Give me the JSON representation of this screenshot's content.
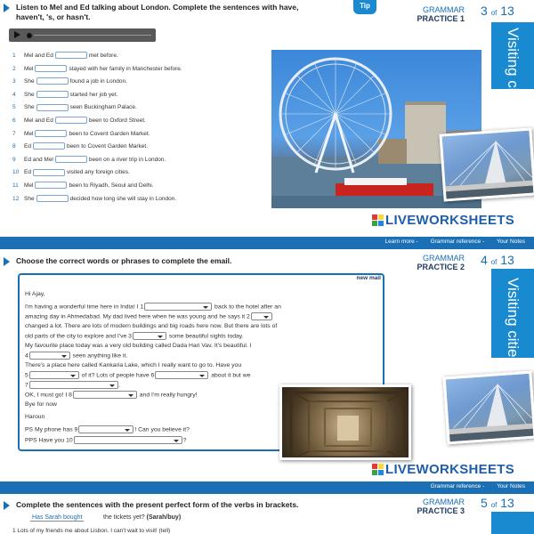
{
  "section1": {
    "instruction_line1": "Listen to Mel and Ed talking about London. Complete the sentences with have,",
    "instruction_line2": "haven't, 's, or hasn't.",
    "tip": "Tip",
    "grammar": "GRAMMAR",
    "practice": "PRACTICE 1",
    "page_num": "3",
    "page_of": "of",
    "page_total": "13",
    "side_tab": "Visiting cities",
    "sentences": [
      {
        "n": "1",
        "before": "Mel and Ed",
        "after": "met before."
      },
      {
        "n": "2",
        "before": "Mel",
        "after": "stayed with her family in Manchester before."
      },
      {
        "n": "3",
        "before": "She",
        "after": "found a job in London."
      },
      {
        "n": "4",
        "before": "She",
        "after": "started her job yet."
      },
      {
        "n": "5",
        "before": "She",
        "after": "seen Buckingham Palace."
      },
      {
        "n": "6",
        "before": "Mel and Ed",
        "after": "been to Oxford Street."
      },
      {
        "n": "7",
        "before": "Mel",
        "after": "been to Covent Garden Market."
      },
      {
        "n": "8",
        "before": "Ed",
        "after": "been to Covent Garden Market."
      },
      {
        "n": "9",
        "before": "Ed and Mel",
        "after": "been on a river trip in London."
      },
      {
        "n": "10",
        "before": "Ed",
        "after": "visited any foreign cities."
      },
      {
        "n": "11",
        "before": "Mel",
        "after": "been to Riyadh, Seoul and Delhi."
      },
      {
        "n": "12",
        "before": "She",
        "after": "decided how long she will stay in London."
      }
    ],
    "footer_links": [
      "Learn more -",
      "Grammar reference -",
      "Your Notes"
    ]
  },
  "brand": "LIVEWORKSHEETS",
  "section2": {
    "instruction": "Choose the correct words or phrases to complete the email.",
    "grammar": "GRAMMAR",
    "practice": "PRACTICE 2",
    "page_num": "4",
    "page_of": "of",
    "page_total": "13",
    "side_tab": "Visiting cities",
    "new_mail": "new mail",
    "greeting": "Hi Ajay,",
    "l1a": "I'm having a wonderful time here in India! I 1",
    "l1b": "back to the hotel after an",
    "l2a": "amazing day in Ahmedabad. My dad lived here when he was young and he says it 2",
    "l3": "changed a lot. There are lots of modern buildings and big roads here now. But there are lots of",
    "l4a": "old parts of the city to explore and I've 3",
    "l4b": "some beautiful sights today.",
    "l5": "My favourite place today was a very old building called Dada Hari Vav. It's beautiful. I",
    "l6a": "4",
    "l6b": "seen anything like it.",
    "l7": "There's a place here called Kankaria Lake, which I really want to go to. Have you",
    "l8a": "5",
    "l8b": "of it? Lots of people have 6",
    "l8c": "about it but we",
    "l9a": "7",
    "l9b": ".",
    "l10a": "OK, I must go! I 8",
    "l10b": "and I'm really hungry!",
    "bye": "Bye for now",
    "name": "Haroun",
    "ps_a": "PS My phone has 9",
    "ps_b": "! Can you believe it?",
    "pps_a": "PPS Have you 10",
    "pps_b": "?",
    "footer_links": [
      "Grammar reference -",
      "Your Notes"
    ]
  },
  "section3": {
    "instruction": "Complete the sentences with the present perfect form of the verbs in brackets.",
    "grammar": "GRAMMAR",
    "practice": "PRACTICE 3",
    "page_num": "5",
    "page_of": "of",
    "page_total": "13",
    "example_answer": "Has Sarah bought",
    "example_rest": "the tickets yet? ",
    "example_verb": "(Sarah/buy)",
    "cut_line": "1  Lots of my friends                           me about Lisbon. I can't wait to visit! (tell)"
  },
  "colors": {
    "accent": "#1a6fb5",
    "side_tab": "#1a8ad0"
  }
}
